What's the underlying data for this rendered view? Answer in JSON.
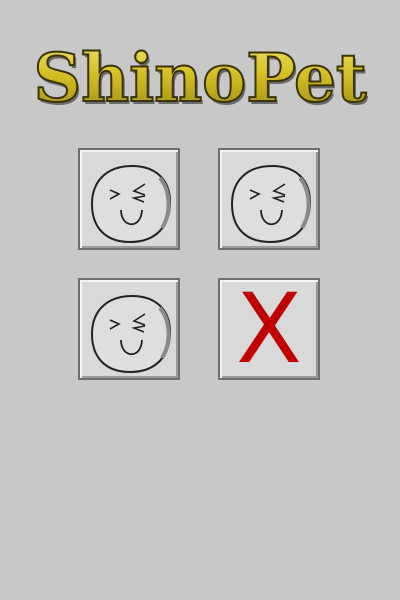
{
  "app": {
    "title": "ShinoPet"
  },
  "colors": {
    "background": "#c8c8c8",
    "title_gold": "#c9b21e",
    "mark_red": "#c00000"
  },
  "grid": {
    "tiles": [
      {
        "content": "smiling-face-icon"
      },
      {
        "content": "smiling-face-icon"
      },
      {
        "content": "smiling-face-icon"
      },
      {
        "content": "x-mark",
        "label": "X"
      }
    ]
  }
}
